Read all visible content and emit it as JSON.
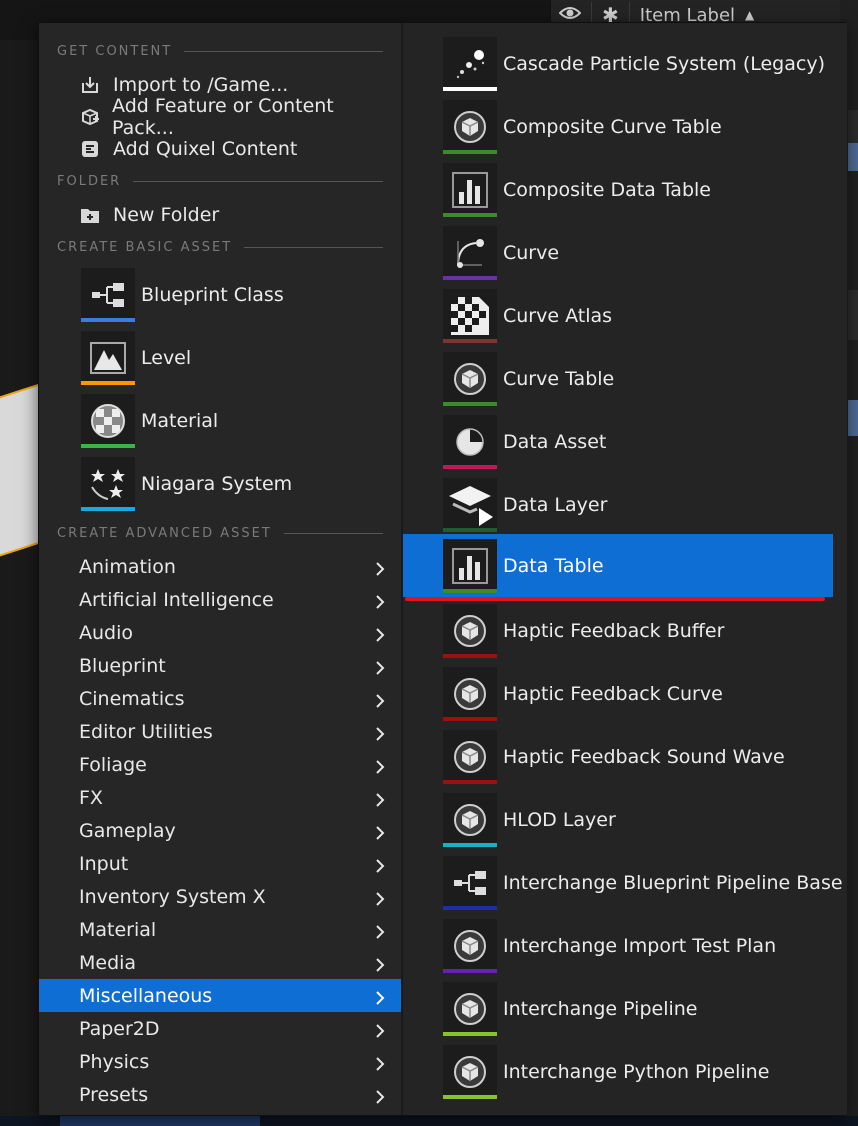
{
  "outliner": {
    "column_label": "Item Label"
  },
  "menu": {
    "sections": {
      "get_content": "GET CONTENT",
      "folder": "FOLDER",
      "create_basic_asset": "CREATE BASIC ASSET",
      "create_advanced_asset": "CREATE ADVANCED ASSET"
    },
    "get_content_items": [
      {
        "label": "Import to /Game...",
        "icon": "import-icon"
      },
      {
        "label": "Add Feature or Content Pack...",
        "icon": "content-pack-icon"
      },
      {
        "label": "Add Quixel Content",
        "icon": "quixel-icon"
      }
    ],
    "folder_items": [
      {
        "label": "New Folder",
        "icon": "new-folder-icon"
      }
    ],
    "basic_assets": [
      {
        "label": "Blueprint Class",
        "icon": "blueprint-icon",
        "color": "#3c7ce0"
      },
      {
        "label": "Level",
        "icon": "level-icon",
        "color": "#ff9800"
      },
      {
        "label": "Material",
        "icon": "material-icon",
        "color": "#39b54a"
      },
      {
        "label": "Niagara System",
        "icon": "niagara-icon",
        "color": "#17a9e6"
      }
    ],
    "categories": [
      {
        "label": "Animation"
      },
      {
        "label": "Artificial Intelligence"
      },
      {
        "label": "Audio"
      },
      {
        "label": "Blueprint"
      },
      {
        "label": "Cinematics"
      },
      {
        "label": "Editor Utilities"
      },
      {
        "label": "Foliage"
      },
      {
        "label": "FX"
      },
      {
        "label": "Gameplay"
      },
      {
        "label": "Input"
      },
      {
        "label": "Inventory System X"
      },
      {
        "label": "Material"
      },
      {
        "label": "Media"
      },
      {
        "label": "Miscellaneous",
        "selected": true
      },
      {
        "label": "Paper2D"
      },
      {
        "label": "Physics"
      },
      {
        "label": "Presets"
      }
    ],
    "misc_assets": [
      {
        "label": "Cascade Particle System (Legacy)",
        "icon": "particle-icon",
        "color": "#ffffff"
      },
      {
        "label": "Composite Curve Table",
        "icon": "cube-icon",
        "color": "#3a8c2a"
      },
      {
        "label": "Composite Data Table",
        "icon": "bar-chart-icon",
        "color": "#3a8c2a"
      },
      {
        "label": "Curve",
        "icon": "curve-icon",
        "color": "#6b2fa6"
      },
      {
        "label": "Curve Atlas",
        "icon": "checker-icon",
        "color": "#7a3535"
      },
      {
        "label": "Curve Table",
        "icon": "cube-icon",
        "color": "#3a8c2a"
      },
      {
        "label": "Data Asset",
        "icon": "pie-icon",
        "color": "#c2185b"
      },
      {
        "label": "Data Layer",
        "icon": "layers-icon",
        "color": "#1e5e2a"
      },
      {
        "label": "Data Table",
        "icon": "bar-chart-icon",
        "color": "#3a8c2a",
        "selected": true
      },
      {
        "label": "Haptic Feedback Buffer",
        "icon": "cube-icon",
        "color": "#9c1010"
      },
      {
        "label": "Haptic Feedback Curve",
        "icon": "cube-icon",
        "color": "#9c1010"
      },
      {
        "label": "Haptic Feedback Sound Wave",
        "icon": "cube-icon",
        "color": "#9c1010"
      },
      {
        "label": "HLOD Layer",
        "icon": "cube-icon",
        "color": "#13b3c4"
      },
      {
        "label": "Interchange Blueprint Pipeline Base",
        "icon": "blueprint-icon",
        "color": "#1a2fa8"
      },
      {
        "label": "Interchange Import Test Plan",
        "icon": "cube-icon",
        "color": "#6a1fb0"
      },
      {
        "label": "Interchange Pipeline",
        "icon": "cube-icon",
        "color": "#8ac22a"
      },
      {
        "label": "Interchange Python Pipeline",
        "icon": "cube-icon",
        "color": "#8ac22a"
      }
    ]
  }
}
